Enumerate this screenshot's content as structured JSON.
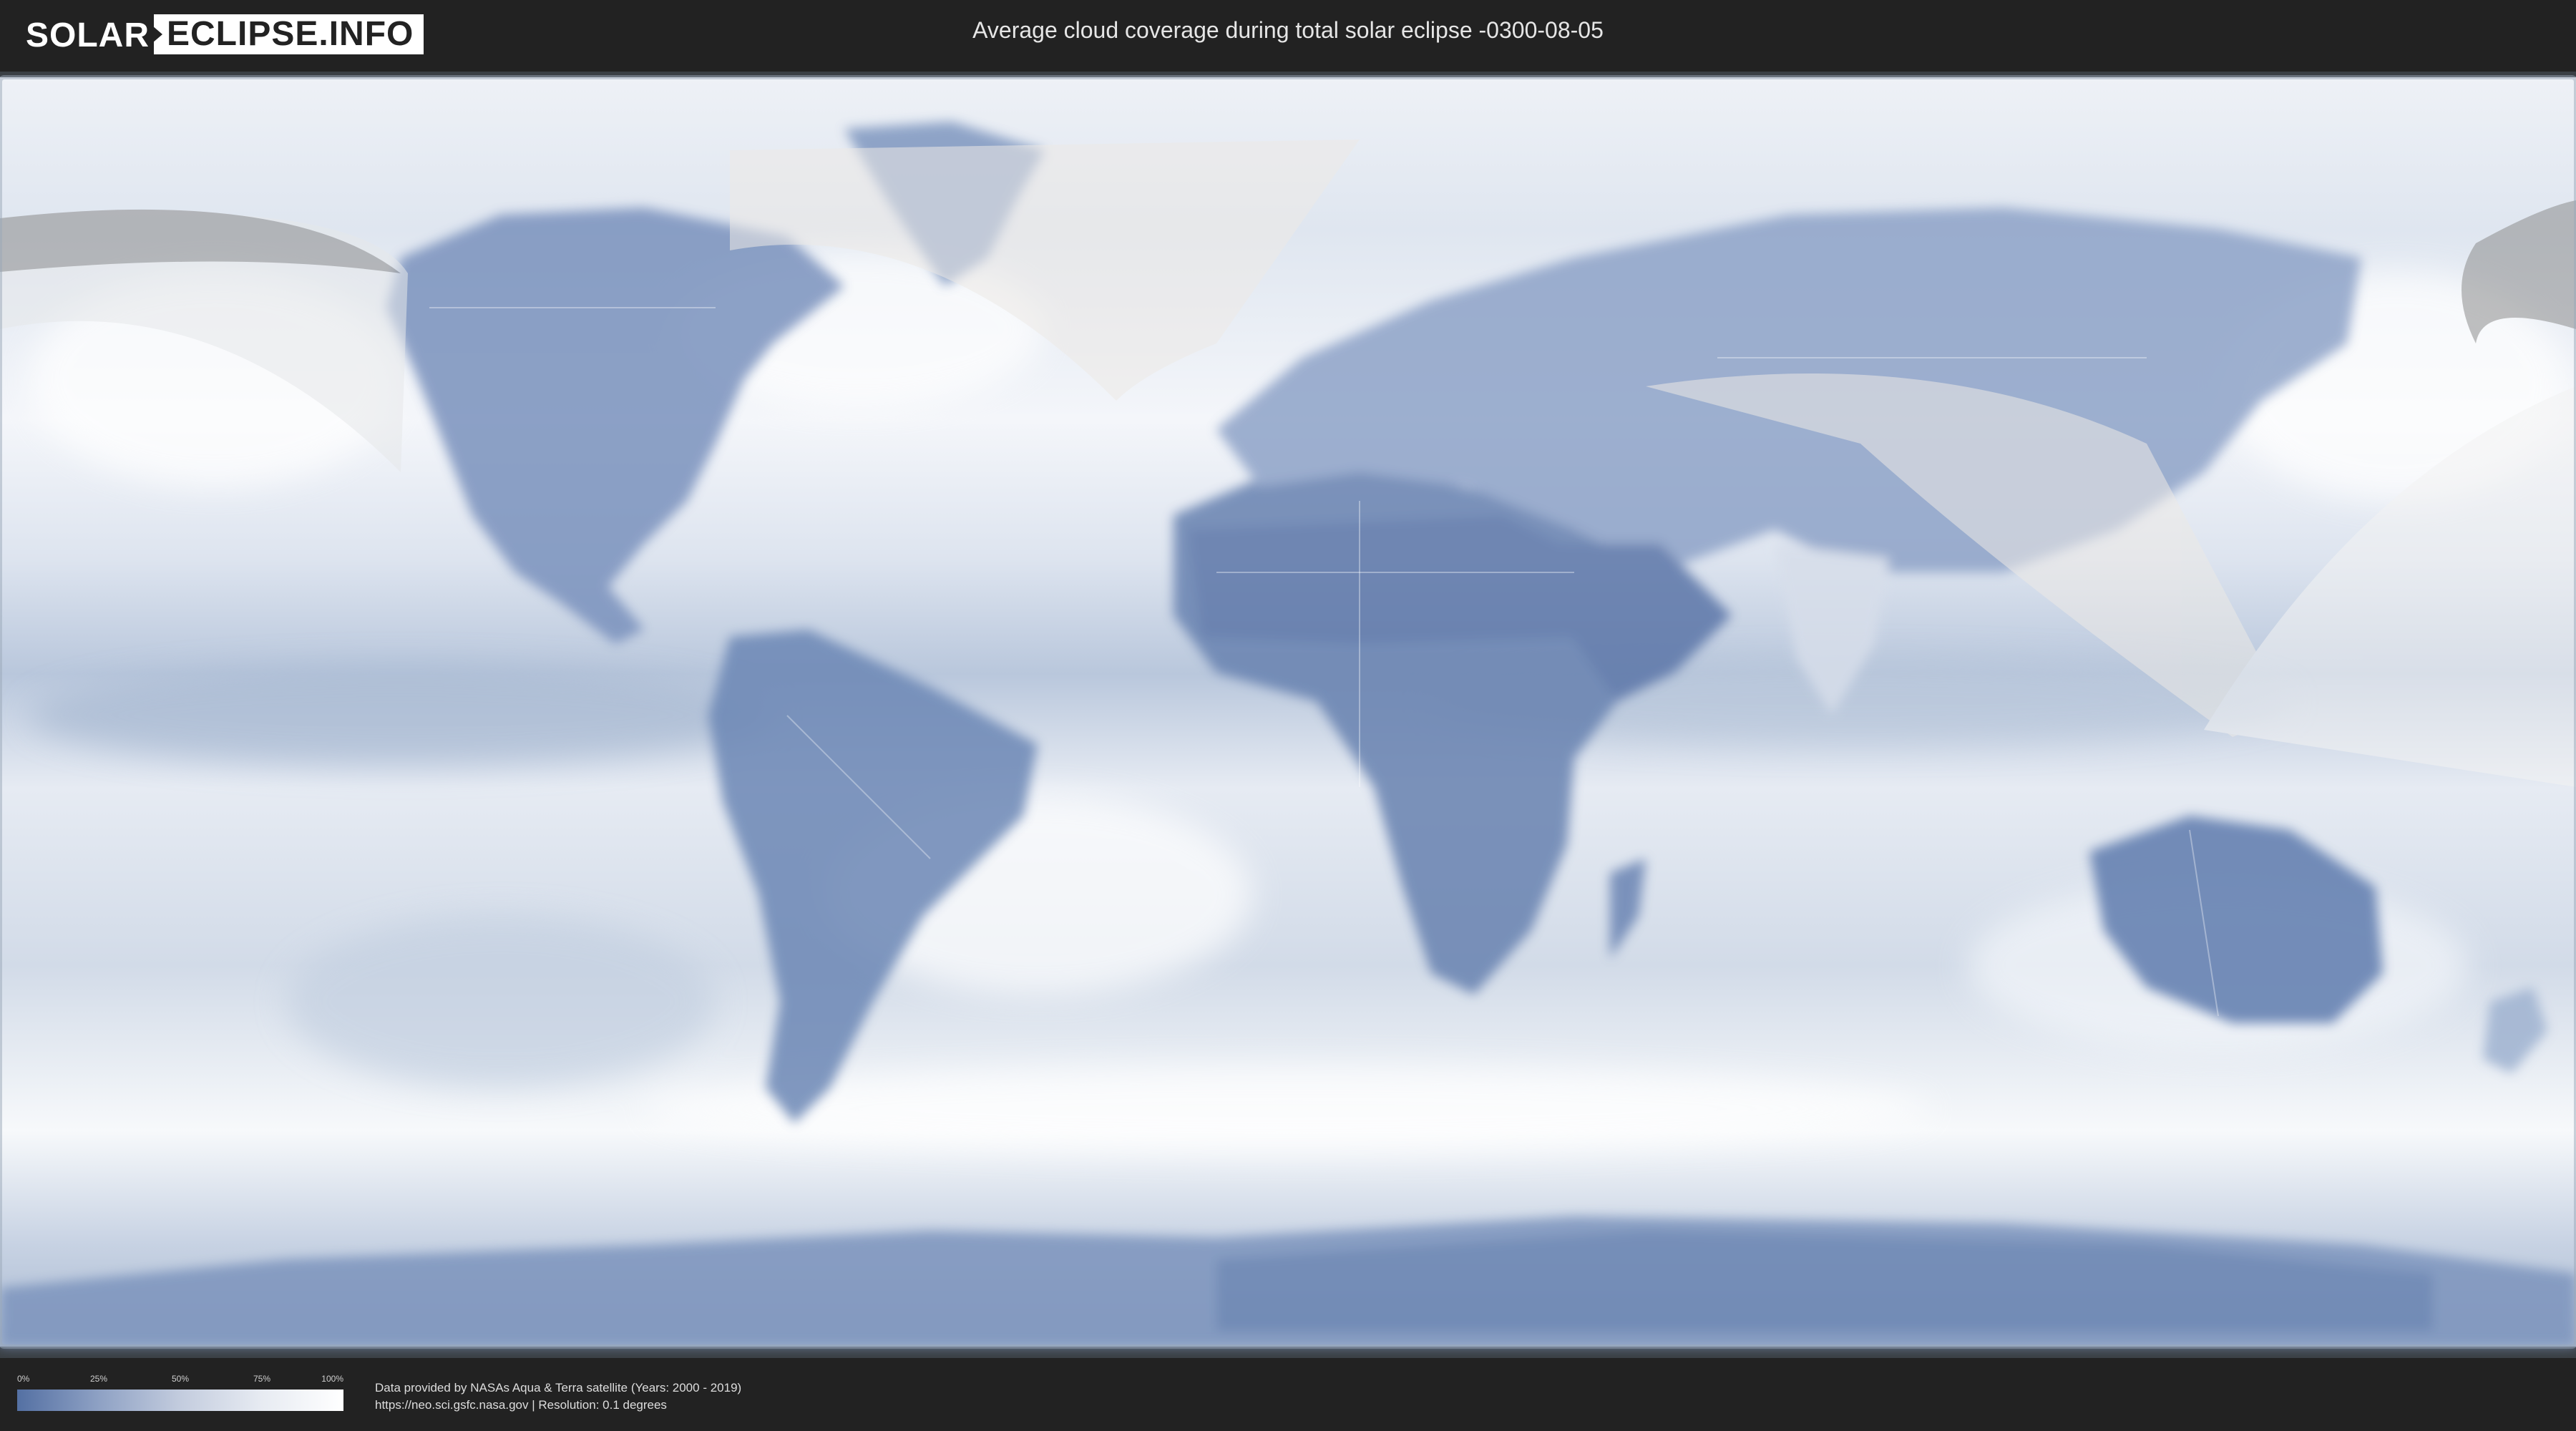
{
  "header": {
    "logo_left": "SOLAR",
    "logo_right": "ECLIPSE.INFO",
    "title": "Average cloud coverage during total solar eclipse -0300-08-05"
  },
  "legend": {
    "ticks": [
      "0%",
      "25%",
      "50%",
      "75%",
      "100%"
    ],
    "colors": [
      "#5470a3",
      "#8ea1c4",
      "#c3ccde",
      "#e7ebf2",
      "#ffffff"
    ]
  },
  "footer": {
    "credit_line": "Data provided by NASAs Aqua & Terra satellite (Years: 2000 - 2019)",
    "source_line": "https://neo.sci.gsfc.nasa.gov | Resolution: 0.1 degrees"
  },
  "map": {
    "type": "cloud-coverage-map",
    "projection": "equirectangular",
    "colors": {
      "clear": "#5470a3",
      "cloudy": "#ffffff",
      "shadow": "#8c8c8c"
    }
  }
}
